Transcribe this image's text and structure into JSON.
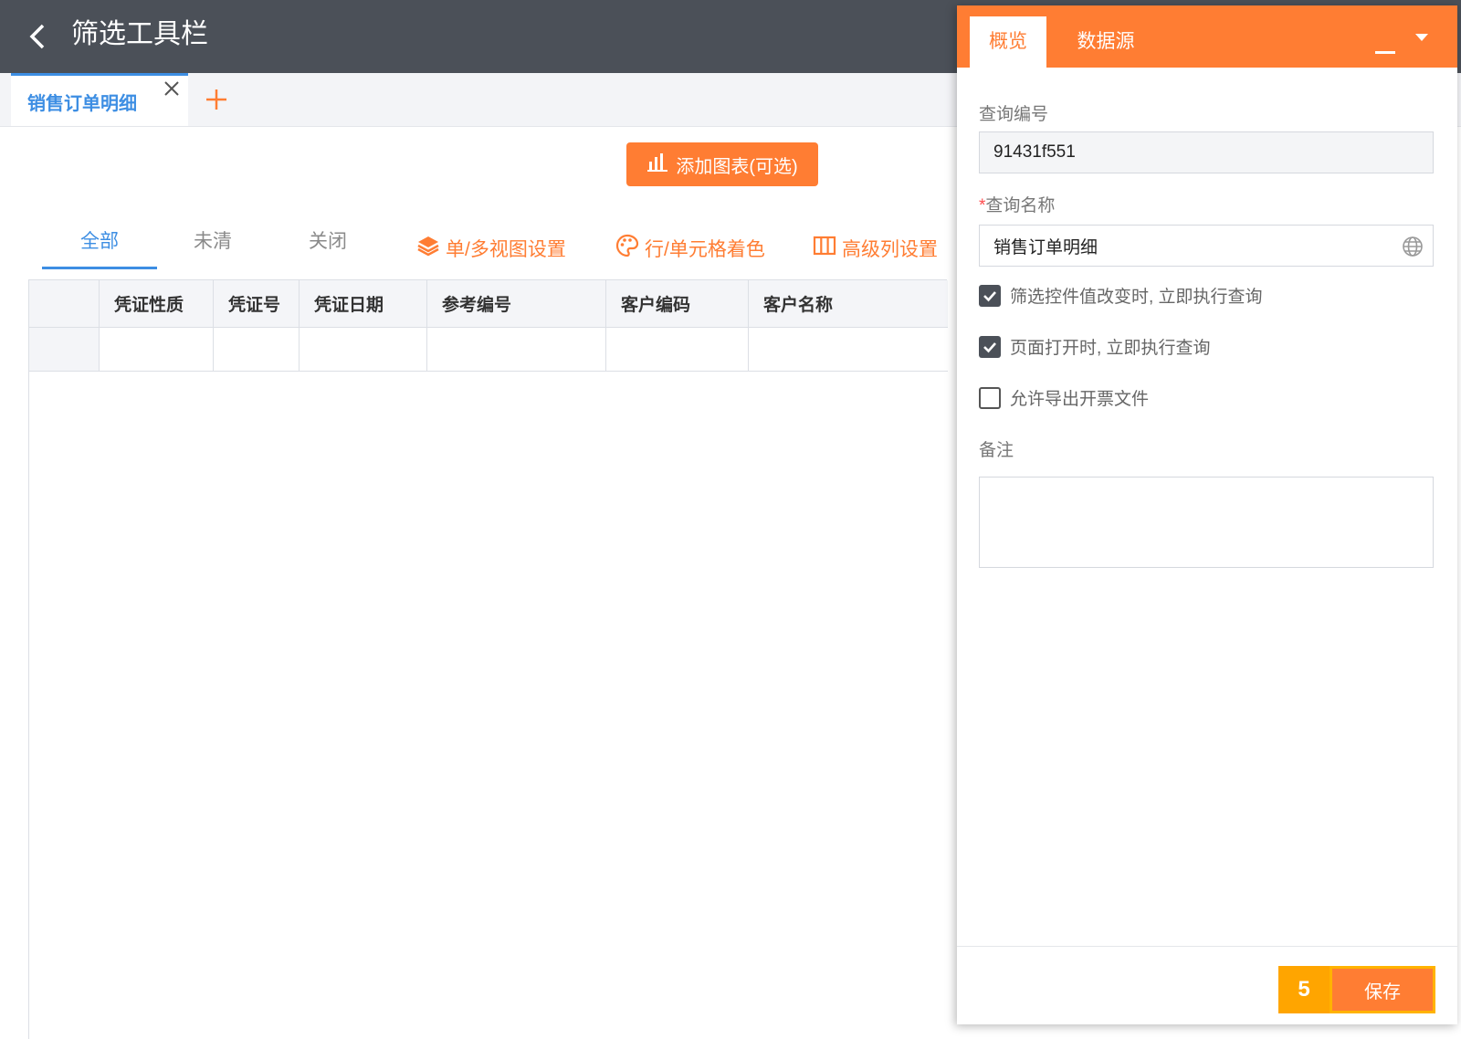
{
  "header": {
    "title": "筛选工具栏"
  },
  "doc_tabs": [
    {
      "label": "销售订单明细"
    }
  ],
  "toolbar": {
    "add_chart_label": "添加图表(可选)"
  },
  "status_tabs": [
    {
      "label": "全部"
    },
    {
      "label": "未清"
    },
    {
      "label": "关闭"
    }
  ],
  "tools": [
    {
      "label": "单/多视图设置",
      "icon": "layers-icon"
    },
    {
      "label": "行/单元格着色",
      "icon": "palette-icon"
    },
    {
      "label": "高级列设置",
      "icon": "columns-icon"
    }
  ],
  "grid": {
    "columns": [
      "凭证性质",
      "凭证号",
      "凭证日期",
      "参考编号",
      "客户编码",
      "客户名称"
    ],
    "rows": [
      [
        "",
        "",
        "",
        "",
        "",
        ""
      ]
    ]
  },
  "panel": {
    "tabs": [
      {
        "label": "概览"
      },
      {
        "label": "数据源"
      }
    ],
    "query_no_label": "查询编号",
    "query_no_value": "91431f551",
    "required_mark": "*",
    "query_name_label": "查询名称",
    "query_name_value": "销售订单明细",
    "checkboxes": [
      {
        "label": "筛选控件值改变时, 立即执行查询",
        "checked": true
      },
      {
        "label": "页面打开时, 立即执行查询",
        "checked": true
      },
      {
        "label": "允许导出开票文件",
        "checked": false
      }
    ],
    "remark_label": "备注",
    "remark_value": "",
    "step_badge": "5",
    "save_label": "保存"
  },
  "colors": {
    "accent": "#ff7d33",
    "header_bg": "#4b5058",
    "link_blue": "#3d8ee3"
  }
}
